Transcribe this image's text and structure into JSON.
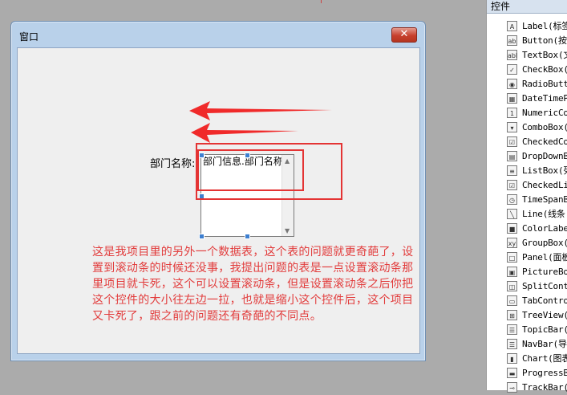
{
  "form": {
    "title": "窗口",
    "close_glyph": "✕"
  },
  "field": {
    "label": "部门名称:",
    "textbox_value": "部门信息.部门名称"
  },
  "note": "这是我项目里的另外一个数据表，这个表的问题就更奇葩了，设置到滚动条的时候还没事，我提出问题的表是一点设置滚动条那里项目就卡死，这个可以设置滚动条，但是设置滚动条之后你把这个控件的大小往左边一拉，也就是缩小这个控件后，这个项目又卡死了，跟之前的问题还有奇葩的不同点。",
  "annotation_color": "#e23c3c",
  "toolbox": {
    "header": "控件",
    "items": [
      {
        "label": "Label(标签",
        "icon": "A"
      },
      {
        "label": "Button(按",
        "icon": "ab"
      },
      {
        "label": "TextBox(文",
        "icon": "abl"
      },
      {
        "label": "CheckBox(",
        "icon": "✓"
      },
      {
        "label": "RadioButto",
        "icon": "◉"
      },
      {
        "label": "DateTimeP",
        "icon": "▦"
      },
      {
        "label": "NumericCo",
        "icon": "1"
      },
      {
        "label": "ComboBox(",
        "icon": "▾"
      },
      {
        "label": "CheckedCo",
        "icon": "☑"
      },
      {
        "label": "DropDownB",
        "icon": "▤"
      },
      {
        "label": "ListBox(列",
        "icon": "≡"
      },
      {
        "label": "CheckedLi",
        "icon": "☑"
      },
      {
        "label": "TimeSpanB",
        "icon": "◷"
      },
      {
        "label": "Line(线条",
        "icon": "╲"
      },
      {
        "label": "ColorLabel",
        "icon": "■"
      },
      {
        "label": "GroupBox(",
        "icon": "xy"
      },
      {
        "label": "Panel(面板",
        "icon": "□"
      },
      {
        "label": "PictureBox",
        "icon": "▣"
      },
      {
        "label": "SplitCont",
        "icon": "◫"
      },
      {
        "label": "TabControl",
        "icon": "▭"
      },
      {
        "label": "TreeView(",
        "icon": "⊞"
      },
      {
        "label": "TopicBar(",
        "icon": "☰"
      },
      {
        "label": "NavBar(导",
        "icon": "☰"
      },
      {
        "label": "Chart(图表",
        "icon": "▮"
      },
      {
        "label": "ProgressBa",
        "icon": "▬"
      },
      {
        "label": "TrackBar(",
        "icon": "⊸"
      }
    ]
  }
}
